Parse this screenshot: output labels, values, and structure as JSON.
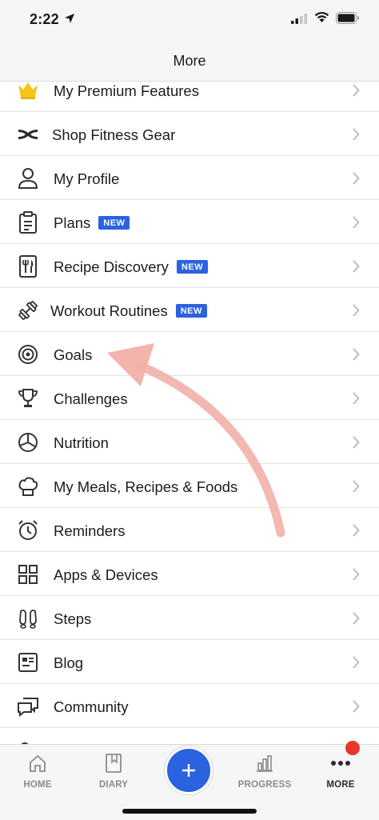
{
  "status_bar": {
    "time": "2:22"
  },
  "nav": {
    "title": "More"
  },
  "menu": {
    "items": [
      {
        "label": "My Premium Features",
        "badge": "",
        "icon": "crown-icon"
      },
      {
        "label": "Shop Fitness Gear",
        "badge": "",
        "icon": "under-armour-icon"
      },
      {
        "label": "My Profile",
        "badge": "",
        "icon": "person-icon"
      },
      {
        "label": "Plans",
        "badge": "NEW",
        "icon": "clipboard-icon"
      },
      {
        "label": "Recipe Discovery",
        "badge": "NEW",
        "icon": "recipe-book-icon"
      },
      {
        "label": "Workout Routines",
        "badge": "NEW",
        "icon": "dumbbell-icon"
      },
      {
        "label": "Goals",
        "badge": "",
        "icon": "target-icon"
      },
      {
        "label": "Challenges",
        "badge": "",
        "icon": "trophy-icon"
      },
      {
        "label": "Nutrition",
        "badge": "",
        "icon": "pie-chart-icon"
      },
      {
        "label": "My Meals, Recipes & Foods",
        "badge": "",
        "icon": "chef-hat-icon"
      },
      {
        "label": "Reminders",
        "badge": "",
        "icon": "alarm-clock-icon"
      },
      {
        "label": "Apps & Devices",
        "badge": "",
        "icon": "grid-icon"
      },
      {
        "label": "Steps",
        "badge": "",
        "icon": "footprints-icon"
      },
      {
        "label": "Blog",
        "badge": "",
        "icon": "newspaper-icon"
      },
      {
        "label": "Community",
        "badge": "",
        "icon": "chat-bubbles-icon"
      }
    ]
  },
  "tab_bar": {
    "tabs": [
      {
        "label": "HOME",
        "icon": "house-icon"
      },
      {
        "label": "DIARY",
        "icon": "book-icon"
      },
      {
        "label": "PROGRESS",
        "icon": "bar-chart-icon"
      },
      {
        "label": "MORE",
        "icon": "ellipsis-icon"
      }
    ],
    "active": "MORE",
    "add_icon": "plus-icon"
  },
  "colors": {
    "accent": "#2a62e0",
    "annotation_arrow": "#f2b0a8",
    "crown": "#f5c518",
    "notification": "#e8362e"
  }
}
